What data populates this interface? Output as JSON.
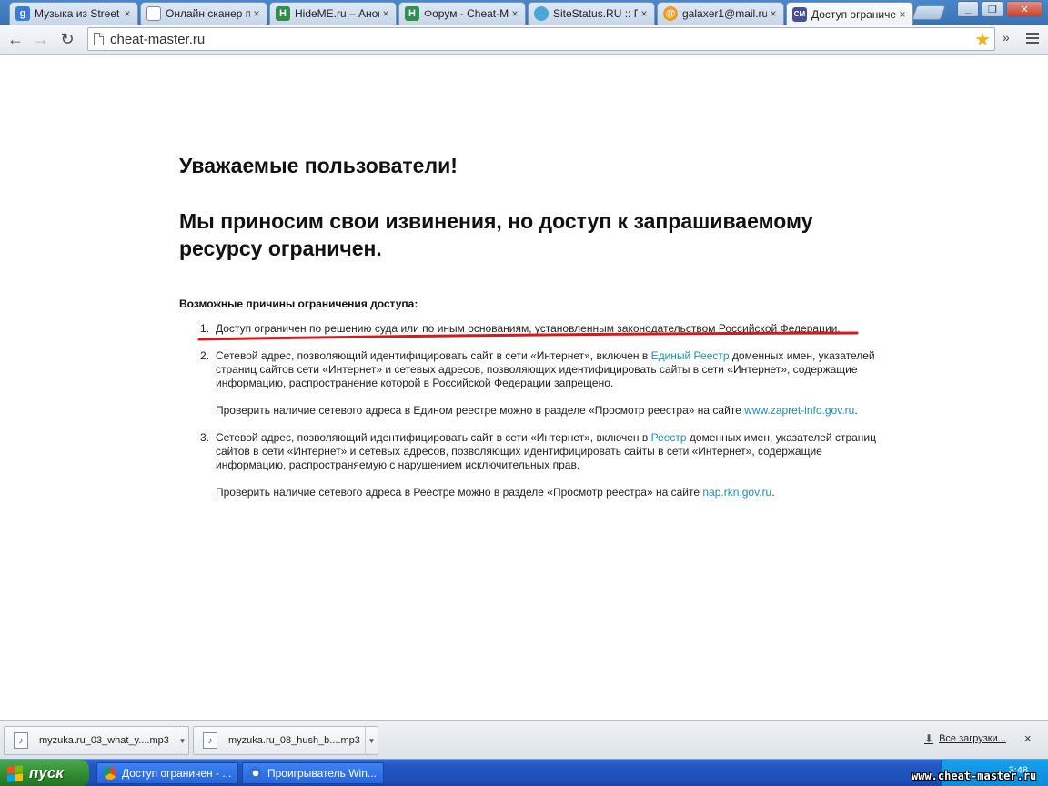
{
  "browser": {
    "tabs": [
      {
        "label": "Музыка из Street",
        "icon": "google-icon",
        "color": "#3b7be0"
      },
      {
        "label": "Онлайн сканер п",
        "icon": "page-icon",
        "color": "#ffffff"
      },
      {
        "label": "HideME.ru – Анон",
        "icon": "hideme-icon",
        "color": "#2f8f4f"
      },
      {
        "label": "Форум - Cheat-M",
        "icon": "hideme-icon",
        "color": "#2f8f4f"
      },
      {
        "label": "SiteStatus.RU :: П",
        "icon": "sitestatus-icon",
        "color": "#4aa6d8"
      },
      {
        "label": "galaxer1@mail.ru",
        "icon": "mail-icon",
        "color": "#f29b1d"
      },
      {
        "label": "Доступ ограниче",
        "icon": "cm-icon",
        "color": "#4b4f8f",
        "active": true
      }
    ],
    "cm_icon_text": "CM",
    "hideme_icon_text": "H",
    "mail_icon_text": "@",
    "close_glyph": "×",
    "url": "cheat-master.ru",
    "extensions_glyph": "»"
  },
  "page": {
    "greeting": "Уважаемые пользователи!",
    "apology": "Мы приносим свои извинения, но доступ к запрашиваемому ресурсу ограничен.",
    "reasons_title": "Возможные причины ограничения доступа:",
    "reasons": [
      {
        "num": "1.",
        "text": "Доступ ограничен  по решению суда или по иным основаниям, установленным законодательством Российской Федерации."
      },
      {
        "num": "2.",
        "text_a": "Сетевой адрес, позволяющий идентифицировать сайт в сети «Интернет», включен в ",
        "link": "Единый Реестр",
        "text_b": " доменных имен, указателей страниц сайтов сети «Интернет» и сетевых адресов, позволяющих идентифицировать сайты в сети «Интернет», содержащие информацию, распространение которой в Российской Федерации запрещено.",
        "check_a": "Проверить наличие сетевого адреса в Едином реестре можно в разделе «Просмотр реестра» на сайте ",
        "check_link": "www.zapret-info.gov.ru",
        "check_b": "."
      },
      {
        "num": "3.",
        "text_a": "Сетевой адрес, позволяющий идентифицировать сайт в сети «Интернет», включен в ",
        "link": "Реестр",
        "text_b": " доменных имен, указателей страниц сайтов в сети «Интернет» и сетевых адресов, позволяющих идентифицировать сайты в сети «Интернет», содержащие информацию, распространяемую с нарушением исключительных прав.",
        "check_a": "Проверить наличие сетевого адреса в Реестре можно в разделе «Просмотр реестра» на сайте ",
        "check_link": "nap.rkn.gov.ru",
        "check_b": "."
      }
    ],
    "link_color": "#1a8fae",
    "annotation_color": "#d41a1a"
  },
  "downloads": {
    "items": [
      {
        "name": "myzuka.ru_03_what_y....mp3",
        "icon": "audio-file-icon"
      },
      {
        "name": "myzuka.ru_08_hush_b....mp3",
        "icon": "audio-file-icon"
      }
    ],
    "show_all": "Все загрузки...",
    "close_glyph": "×"
  },
  "taskbar": {
    "start": "пуск",
    "buttons": [
      {
        "label": "Доступ ограничен - ...",
        "icon": "chrome-icon"
      },
      {
        "label": "Проигрыватель Win...",
        "icon": "media-player-icon"
      }
    ],
    "clock": "3:48"
  },
  "watermark": "www.cheat-master.ru"
}
